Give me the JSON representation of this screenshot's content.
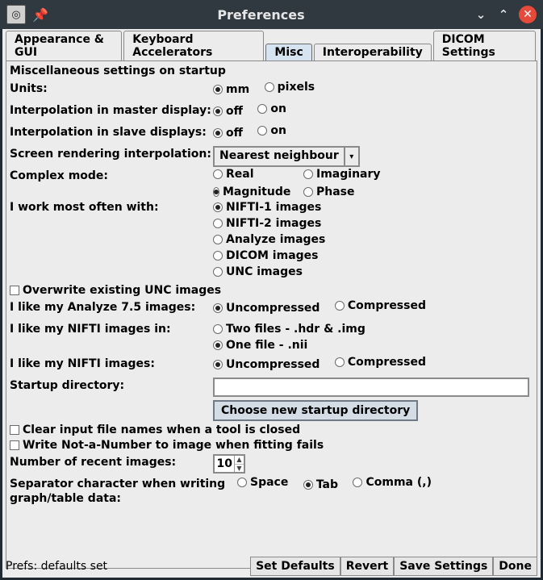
{
  "window": {
    "title": "Preferences"
  },
  "tabs": [
    {
      "label": "Appearance & GUI"
    },
    {
      "label": "Keyboard Accelerators"
    },
    {
      "label": "Misc"
    },
    {
      "label": "Interoperability"
    },
    {
      "label": "DICOM Settings"
    }
  ],
  "active_tab": 2,
  "section_title": "Miscellaneous settings on startup",
  "labels": {
    "units": "Units:",
    "interp_master": "Interpolation in master display:",
    "interp_slave": "Interpolation in slave displays:",
    "screen_render": "Screen rendering interpolation:",
    "complex_mode": "Complex mode:",
    "work_most": "I work most often with:",
    "overwrite_unc": "Overwrite existing UNC images",
    "analyze75": "I like my Analyze 7.5 images:",
    "nifti_in": "I like my NIFTI images in:",
    "nifti_comp": "I like my NIFTI images:",
    "startup_dir": "Startup directory:",
    "choose_dir": "Choose new startup directory",
    "clear_input": "Clear input file names when a tool is closed",
    "write_nan": "Write Not-a-Number to image when fitting fails",
    "num_recent": "Number of recent images:",
    "sep_char": "Separator character when writing graph/table data:"
  },
  "options": {
    "units": [
      {
        "label": "mm",
        "selected": true
      },
      {
        "label": "pixels",
        "selected": false
      }
    ],
    "offon_master": [
      {
        "label": "off",
        "selected": true
      },
      {
        "label": "on",
        "selected": false
      }
    ],
    "offon_slave": [
      {
        "label": "off",
        "selected": true
      },
      {
        "label": "on",
        "selected": false
      }
    ],
    "screen_render_value": "Nearest neighbour",
    "complex": [
      {
        "label": "Real",
        "selected": false
      },
      {
        "label": "Imaginary",
        "selected": false
      },
      {
        "label": "Magnitude",
        "selected": true
      },
      {
        "label": "Phase",
        "selected": false
      }
    ],
    "work_most": [
      {
        "label": "NIFTI-1 images",
        "selected": true
      },
      {
        "label": "NIFTI-2 images",
        "selected": false
      },
      {
        "label": "Analyze images",
        "selected": false
      },
      {
        "label": "DICOM images",
        "selected": false
      },
      {
        "label": "UNC images",
        "selected": false
      }
    ],
    "overwrite_unc_checked": false,
    "analyze75": [
      {
        "label": "Uncompressed",
        "selected": true
      },
      {
        "label": "Compressed",
        "selected": false
      }
    ],
    "nifti_in": [
      {
        "label": "Two files - .hdr & .img",
        "selected": false
      },
      {
        "label": "One file - .nii",
        "selected": true
      }
    ],
    "nifti_comp": [
      {
        "label": "Uncompressed",
        "selected": true
      },
      {
        "label": "Compressed",
        "selected": false
      }
    ],
    "startup_dir_value": "",
    "clear_input_checked": false,
    "write_nan_checked": false,
    "num_recent_value": "10",
    "sep_char": [
      {
        "label": "Space",
        "selected": false
      },
      {
        "label": "Tab",
        "selected": true
      },
      {
        "label": "Comma (,)",
        "selected": false
      }
    ]
  },
  "footer": {
    "status": "Prefs: defaults set",
    "buttons": [
      "Set Defaults",
      "Revert",
      "Save Settings",
      "Done"
    ]
  }
}
